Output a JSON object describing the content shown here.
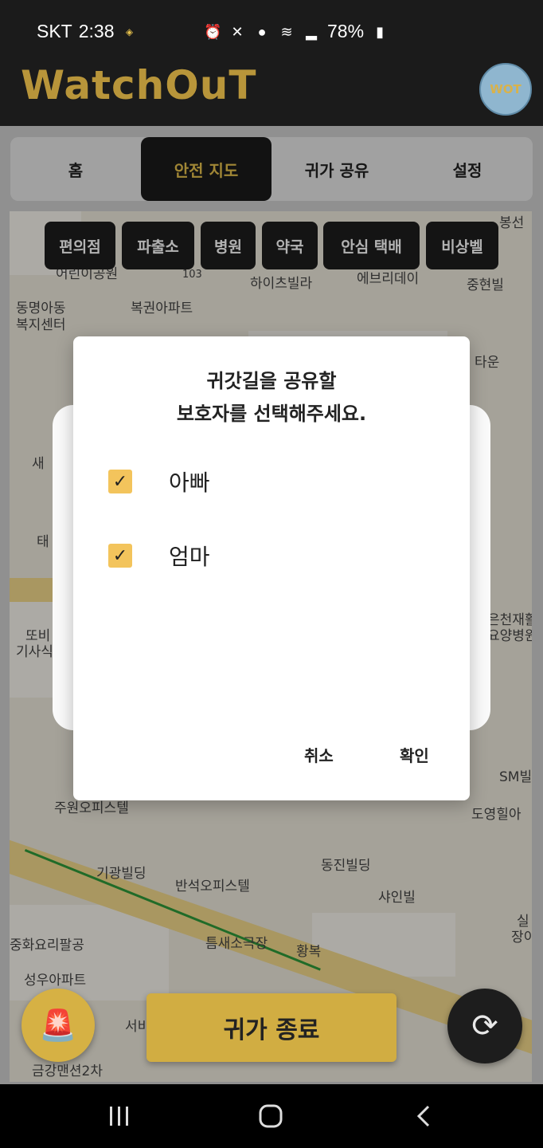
{
  "status_bar": {
    "carrier": "SKT",
    "time": "2:38",
    "battery": "78%",
    "icons": [
      "wot-app-icon",
      "alarm-icon",
      "mute-icon",
      "location-icon",
      "wifi-icon",
      "signal-icon",
      "battery-icon"
    ]
  },
  "header": {
    "logo": "WatchOuT",
    "avatar_text": "WOT"
  },
  "tabs": [
    {
      "label": "홈"
    },
    {
      "label": "안전 지도"
    },
    {
      "label": "귀가 공유"
    },
    {
      "label": "설정"
    }
  ],
  "active_tab": "안전 지도",
  "map_filters": [
    {
      "label": "편의점"
    },
    {
      "label": "파출소"
    },
    {
      "label": "병원"
    },
    {
      "label": "약국"
    },
    {
      "label": "안심 택배"
    },
    {
      "label": "비상벨"
    }
  ],
  "map_labels": [
    "봉선",
    "103",
    "하이츠빌라",
    "에브리데이",
    "중현빌",
    "동명아동",
    "복지센터",
    "복권아파트",
    "타운",
    "새",
    "태",
    "또비",
    "기사식",
    "은천재활",
    "요양병원",
    "SM빌",
    "주원오피스텔",
    "도영힐아",
    "기광빌딩",
    "동진빌딩",
    "반석오피스텔",
    "샤인빌",
    "실",
    "장이",
    "중화요리팔공",
    "틈새소극장",
    "황복",
    "성우아파트",
    "서비",
    "금강맨션2차",
    "어린이공원"
  ],
  "dialog": {
    "title_line1": "귀갓길을 공유할",
    "title_line2": "보호자를 선택해주세요.",
    "options": [
      {
        "label": "아빠",
        "checked": true
      },
      {
        "label": "엄마",
        "checked": true
      }
    ],
    "cancel_label": "취소",
    "confirm_label": "확인"
  },
  "bottom": {
    "end_button_label": "귀가 종료",
    "alert_icon": "siren-icon",
    "refresh_icon": "refresh-icon"
  },
  "colors": {
    "accent_gold": "#d1ad42",
    "checkbox_yellow": "#f3c45c",
    "header_dark": "#1b1b1b"
  }
}
